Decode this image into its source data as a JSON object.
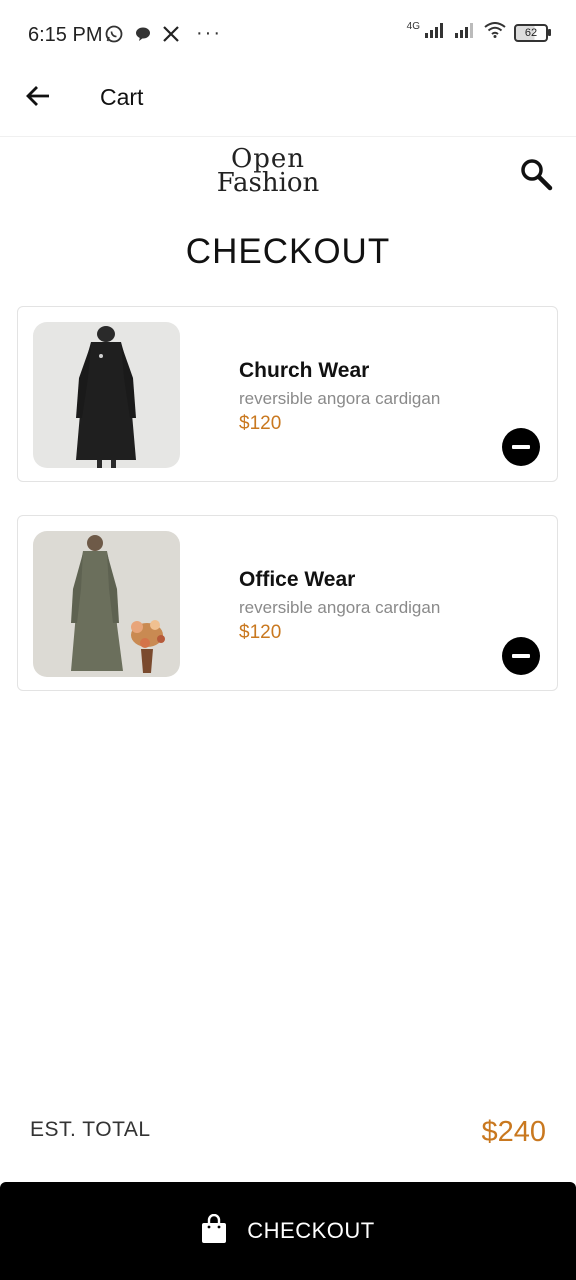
{
  "status_bar": {
    "time": "6:15 PM",
    "network": "4G",
    "battery": "62",
    "more": "···",
    "icons": [
      "whatsapp-icon",
      "chat-bubble-icon",
      "x-icon",
      "more-icon",
      "signal-icon",
      "wifi-icon",
      "battery-icon"
    ]
  },
  "app_bar": {
    "title": "Cart",
    "back_icon": "arrow-left-icon"
  },
  "brand": {
    "logo_line1": "Open",
    "logo_line2": "Fashion",
    "search_icon": "search-icon"
  },
  "page": {
    "title": "CHECKOUT"
  },
  "cart": {
    "items": [
      {
        "name": "Church Wear",
        "description": "reversible angora cardigan",
        "price": "$120",
        "image": "black-dress-photo"
      },
      {
        "name": "Office Wear",
        "description": "reversible angora cardigan",
        "price": "$120",
        "image": "olive-dress-photo"
      }
    ],
    "remove_icon": "remove-circle-icon"
  },
  "summary": {
    "total_label": "EST. TOTAL",
    "total_value": "$240"
  },
  "checkout": {
    "label": "CHECKOUT",
    "icon": "shopping-bag-icon"
  },
  "colors": {
    "accent": "#c9781f",
    "primary": "#000000",
    "muted_text": "#8a8a8a",
    "border": "#e3e3e3"
  }
}
